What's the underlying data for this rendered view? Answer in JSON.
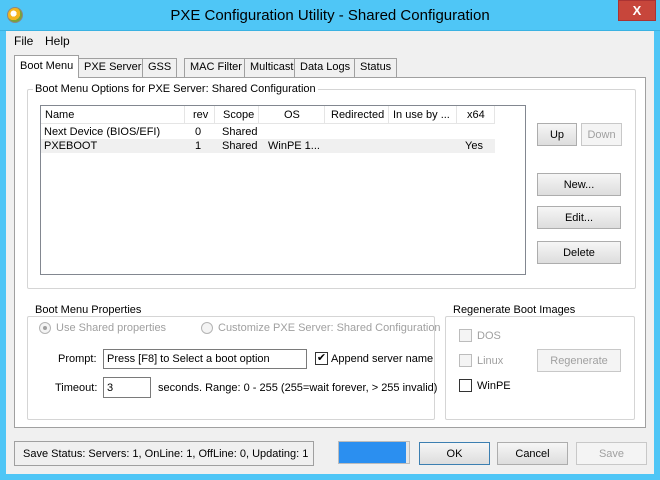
{
  "window": {
    "title": "PXE Configuration Utility - Shared Configuration",
    "close_glyph": "X"
  },
  "menu": [
    "File",
    "Help"
  ],
  "tabs": [
    "Boot Menu",
    "PXE Server",
    "GSS",
    "MAC Filter",
    "Multicast",
    "Data Logs",
    "Status"
  ],
  "boot_menu_options": {
    "group_label": "Boot Menu Options for PXE Server:  Shared Configuration",
    "columns": [
      "Name",
      "rev",
      "Scope",
      "OS",
      "Redirected",
      "In use by ...",
      "x64"
    ],
    "rows": [
      [
        "Next Device (BIOS/EFI)",
        "0",
        "Shared",
        "",
        "",
        "",
        ""
      ],
      [
        "PXEBOOT",
        "1",
        "Shared",
        "WinPE 1...",
        "",
        "",
        "Yes"
      ]
    ],
    "buttons": {
      "up": "Up",
      "down": "Down",
      "new": "New...",
      "edit": "Edit...",
      "delete": "Delete"
    }
  },
  "boot_menu_properties": {
    "group_label": "Boot Menu Properties",
    "use_shared": "Use Shared properties",
    "customize": "Customize PXE Server:  Shared Configuration",
    "prompt_label": "Prompt:",
    "prompt_value": "Press [F8] to Select a boot option",
    "append_server_name": "Append server name",
    "append_check_glyph": "✔",
    "timeout_label": "Timeout:",
    "timeout_value": "3",
    "timeout_hint": "seconds.  Range: 0 - 255 (255=wait forever, > 255 invalid)"
  },
  "regenerate": {
    "group_label": "Regenerate Boot Images",
    "dos": "DOS",
    "linux": "Linux",
    "winpe": "WinPE",
    "regenerate_button": "Regenerate"
  },
  "status": {
    "save_status": "Save Status:  Servers: 1,  OnLine: 1,  OffLine: 0,  Updating: 1",
    "progress_percent": 95,
    "progress_color": "#2b8ff0"
  },
  "footer_buttons": {
    "ok": "OK",
    "cancel": "Cancel",
    "save": "Save"
  },
  "colors": {
    "titlebar": "#4fc6f6",
    "close": "#c7463b"
  }
}
